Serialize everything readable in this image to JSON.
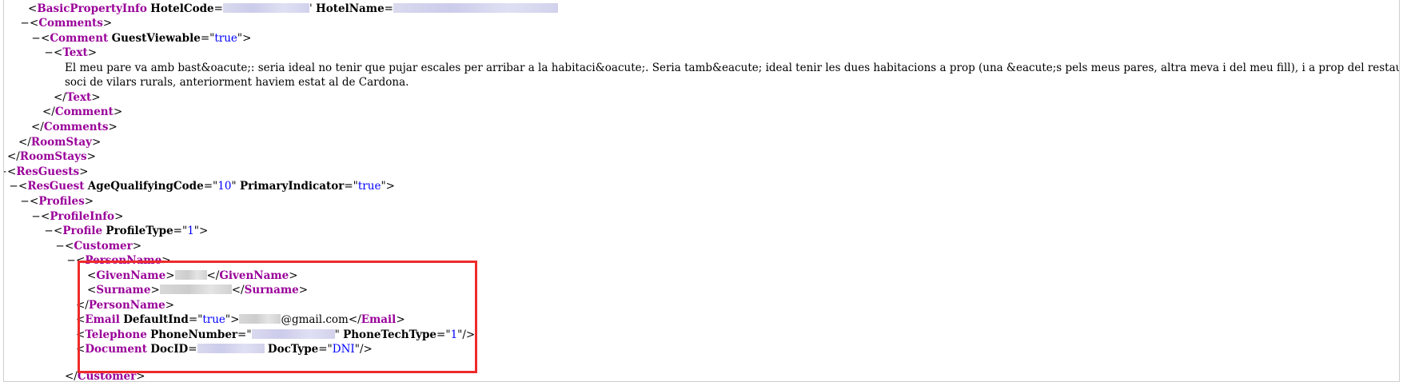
{
  "xml": {
    "basic_property": {
      "tag": "BasicPropertyInfo",
      "attr_hotel_code": "HotelCode",
      "attr_hotel_name": "HotelName",
      "quote_char": "'"
    },
    "comments_tag": "Comments",
    "comment": {
      "tag": "Comment",
      "attr": "GuestViewable",
      "value": "true"
    },
    "text_tag": "Text",
    "text_content_line1": "El meu pare va amb bast&oacute;: seria ideal no tenir que pujar escales per arribar a la habitaci&oacute;. Seria tamb&eacute; ideal tenir les dues habitacions a prop (una &eacute;s pels meus pares, altra meva i del meu fill), i a prop del restaurant. S&oacute;c",
    "text_content_line2": "soci de vilars rurals, anteriorment haviem estat al de Cardona.",
    "roomstay_tag": "RoomStay",
    "roomstays_tag": "RoomStays",
    "resguests_tag": "ResGuests",
    "resguest": {
      "tag": "ResGuest",
      "attr1": "AgeQualifyingCode",
      "val1": "10",
      "attr2": "PrimaryIndicator",
      "val2": "true"
    },
    "profiles_tag": "Profiles",
    "profileinfo_tag": "ProfileInfo",
    "profile": {
      "tag": "Profile",
      "attr": "ProfileType",
      "value": "1"
    },
    "customer_tag": "Customer",
    "personname_tag": "PersonName",
    "givenname_tag": "GivenName",
    "surname_tag": "Surname",
    "email": {
      "tag": "Email",
      "attr": "DefaultInd",
      "value": "true",
      "text_suffix": "@gmail.com"
    },
    "telephone": {
      "tag": "Telephone",
      "attr1": "PhoneNumber",
      "attr2": "PhoneTechType",
      "val2": "1"
    },
    "document": {
      "tag": "Document",
      "attr1": "DocID",
      "attr2": "DocType",
      "val2": "DNI"
    }
  },
  "colors": {
    "tag": "#990099",
    "value": "#0000ff",
    "highlight": "#ee2b2b"
  }
}
